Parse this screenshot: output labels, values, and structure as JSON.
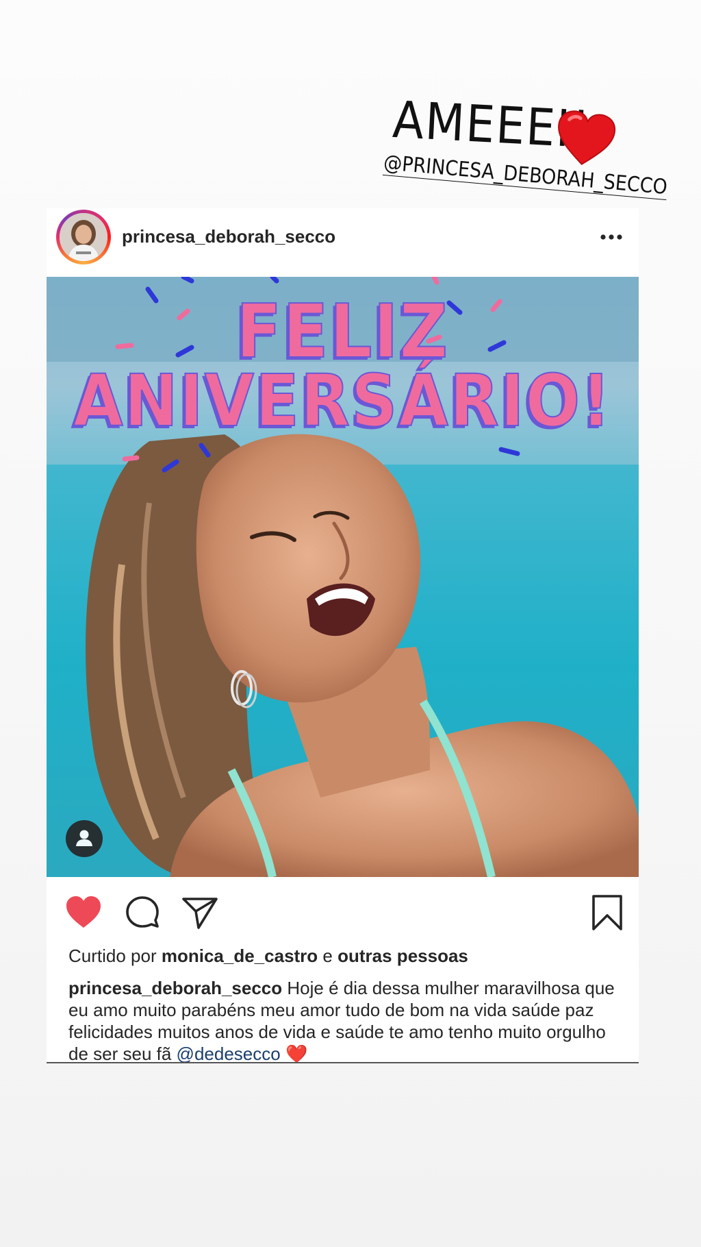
{
  "story": {
    "sticker_text": "AMEEEI!",
    "sticker_tag": "@PRINCESA_DEBORAH_SECCO",
    "heart_icon": "red-heart-emoji"
  },
  "post": {
    "username": "princesa_deborah_secco",
    "more_icon": "ellipsis-icon",
    "image": {
      "headline_line1": "FELIZ",
      "headline_line2": "ANIVERSÁRIO!",
      "tag_icon": "person-icon"
    },
    "actions": {
      "like_icon": "heart-filled-icon",
      "comment_icon": "comment-icon",
      "share_icon": "paper-plane-icon",
      "save_icon": "bookmark-icon",
      "liked": true
    },
    "likes": {
      "prefix": "Curtido por",
      "user": "monica_de_castro",
      "connector": "e",
      "others": "outras pessoas"
    },
    "caption": {
      "username": "princesa_deborah_secco",
      "text": "Hoje é dia dessa mulher maravilhosa que eu amo muito parabéns meu amor tudo de  bom na vida saúde paz felicidades muitos anos de vida e saúde te amo tenho muito orgulho de ser seu fã",
      "mention": "@dedesecco",
      "emoji": "❤️"
    }
  },
  "colors": {
    "heart": "#ed4956",
    "text": "#262626",
    "mention": "#1b3f6e",
    "headline_pink": "#f06b9d",
    "headline_outline": "#6a58d6"
  }
}
